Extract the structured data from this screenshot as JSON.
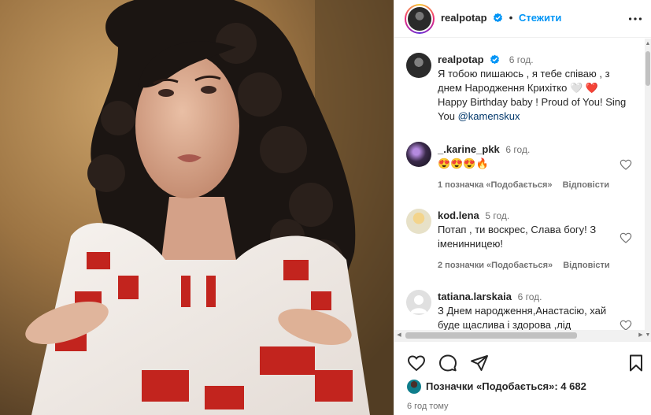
{
  "header": {
    "username": "realpotap",
    "separator": "•",
    "follow_label": "Стежити",
    "more_icon": "more-horizontal-icon"
  },
  "caption": {
    "username": "realpotap",
    "time": "6 год.",
    "text": "Я тобою пишаюсь , я тебе співаю , з днем Народження Крихітко 🤍 ❤️ Happy Birthday baby ! Proud of You! Sing You",
    "mention": "@kamenskux"
  },
  "comments": [
    {
      "username": "_.karine_pkk",
      "time": "6 год.",
      "text": "😍😍😍🔥",
      "likes": "1 позначка «Подобається»",
      "reply": "Відповісти"
    },
    {
      "username": "kod.lena",
      "time": "5 год.",
      "text": "Потап , ти воскрес, Слава богу! З іменинницею!",
      "likes": "2 позначки «Подобається»",
      "reply": "Відповісти"
    },
    {
      "username": "tatiana.larskaia",
      "time": "6 год.",
      "text": "З Днем народження,Анастасію, хай буде щаслива і здорова ,лід",
      "likes": "",
      "reply": ""
    }
  ],
  "footer": {
    "likes_text": "Позначки «Подобається»: 4 682",
    "time_ago": "6 год тому"
  },
  "colors": {
    "accent": "#0095f6",
    "text": "#262626",
    "muted": "#737373",
    "like_red": "#ed4956"
  }
}
